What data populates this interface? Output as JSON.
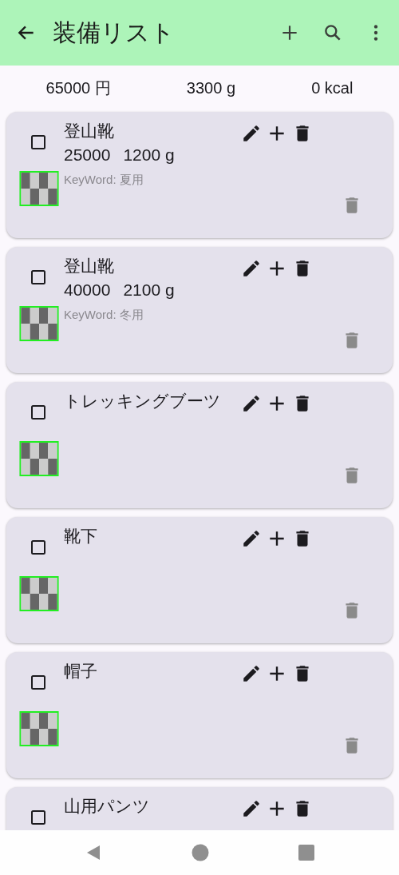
{
  "app_bar": {
    "title": "装備リスト"
  },
  "summary": {
    "price": "65000 円",
    "weight": "3300 g",
    "calories": "0 kcal"
  },
  "items": [
    {
      "name": "登山靴",
      "checked": false,
      "price": "25000",
      "weight": "1200 g",
      "keyword": "KeyWord: 夏用"
    },
    {
      "name": "登山靴",
      "checked": false,
      "price": "40000",
      "weight": "2100 g",
      "keyword": "KeyWord: 冬用"
    },
    {
      "name": "トレッキングブーツ",
      "checked": false
    },
    {
      "name": "靴下",
      "checked": false
    },
    {
      "name": "帽子",
      "checked": false
    },
    {
      "name": "山用パンツ",
      "checked": false
    }
  ]
}
